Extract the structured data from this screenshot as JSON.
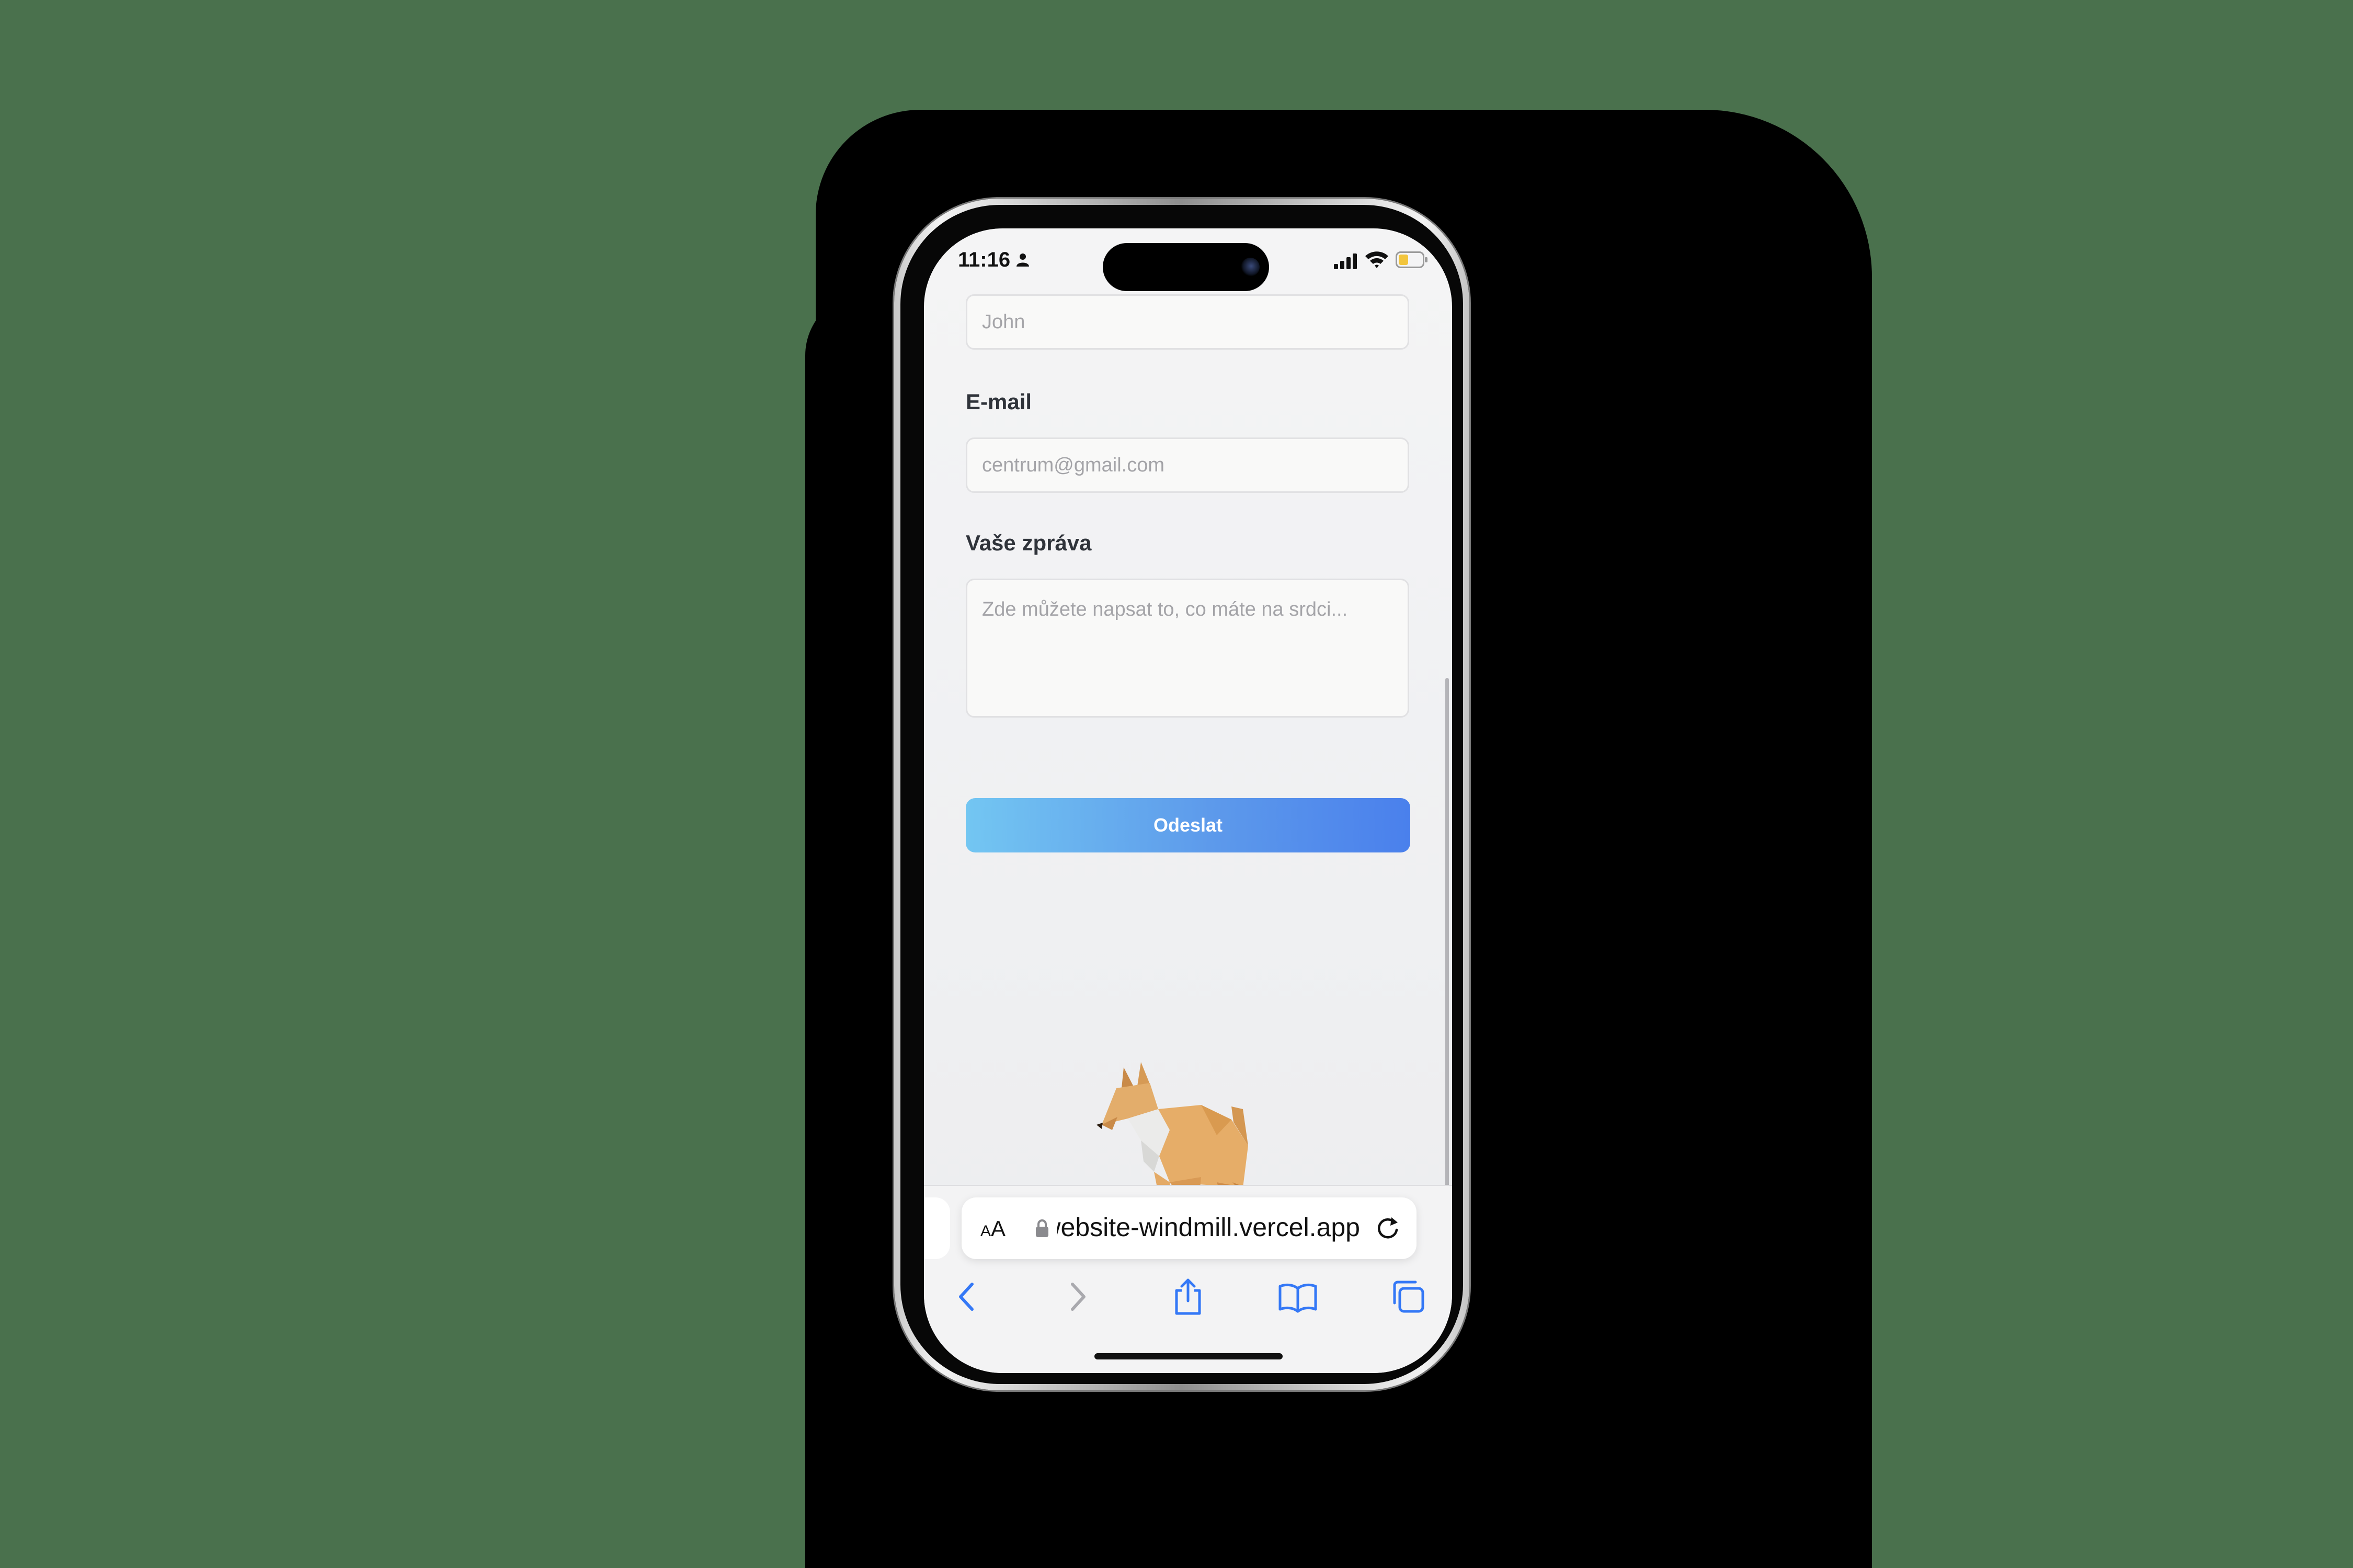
{
  "status_bar": {
    "time": "11:16"
  },
  "form": {
    "name_placeholder": "John",
    "email_label": "E-mail",
    "email_placeholder": "centrum@gmail.com",
    "message_label": "Vaše zpráva",
    "message_placeholder": "Zde můžete napsat to, co máte na srdci...",
    "submit_label": "Odeslat",
    "submit_gradient": [
      "#73c6f2",
      "#4a80ec"
    ]
  },
  "browser": {
    "text_size_label_small": "A",
    "text_size_label_large": "A",
    "url": "website-windmill.vercel.app",
    "accent_color": "#3478f6"
  }
}
